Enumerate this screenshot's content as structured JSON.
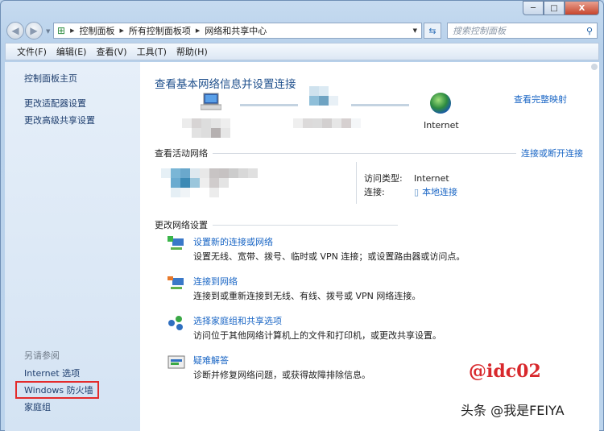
{
  "window": {
    "min": "─",
    "max": "□",
    "close": "X"
  },
  "address": {
    "path": [
      "控制面板",
      "所有控制面板项",
      "网络和共享中心"
    ]
  },
  "search": {
    "placeholder": "搜索控制面板"
  },
  "menu": [
    "文件(F)",
    "编辑(E)",
    "查看(V)",
    "工具(T)",
    "帮助(H)"
  ],
  "sidebar": {
    "top": [
      "控制面板主页",
      "更改适配器设置",
      "更改高级共享设置"
    ],
    "see_also": "另请参阅",
    "bottom": [
      "Internet 选项",
      "Windows 防火墙",
      "家庭组"
    ]
  },
  "main": {
    "title": "查看基本网络信息并设置连接",
    "full_map": "查看完整映射",
    "internet_label": "Internet",
    "active_header": "查看活动网络",
    "connect_disconnect": "连接或断开连接",
    "access_type_label": "访问类型:",
    "access_type_value": "Internet",
    "connection_label": "连接:",
    "connection_value": "本地连接",
    "change_header": "更改网络设置",
    "tasks": [
      {
        "title": "设置新的连接或网络",
        "desc": "设置无线、宽带、拨号、临时或 VPN 连接；或设置路由器或访问点。",
        "icon": "new-connection-icon"
      },
      {
        "title": "连接到网络",
        "desc": "连接到或重新连接到无线、有线、拨号或 VPN 网络连接。",
        "icon": "connect-network-icon"
      },
      {
        "title": "选择家庭组和共享选项",
        "desc": "访问位于其他网络计算机上的文件和打印机，或更改共享设置。",
        "icon": "homegroup-icon"
      },
      {
        "title": "疑难解答",
        "desc": "诊断并修复网络问题，或获得故障排除信息。",
        "icon": "troubleshoot-icon"
      }
    ]
  },
  "overlay": {
    "tag": "@idc02",
    "watermark": "头条 @我是FEIYA"
  },
  "colors": {
    "link": "#1a66c5",
    "title": "#1e4f8c",
    "highlight": "#e32b2b"
  }
}
